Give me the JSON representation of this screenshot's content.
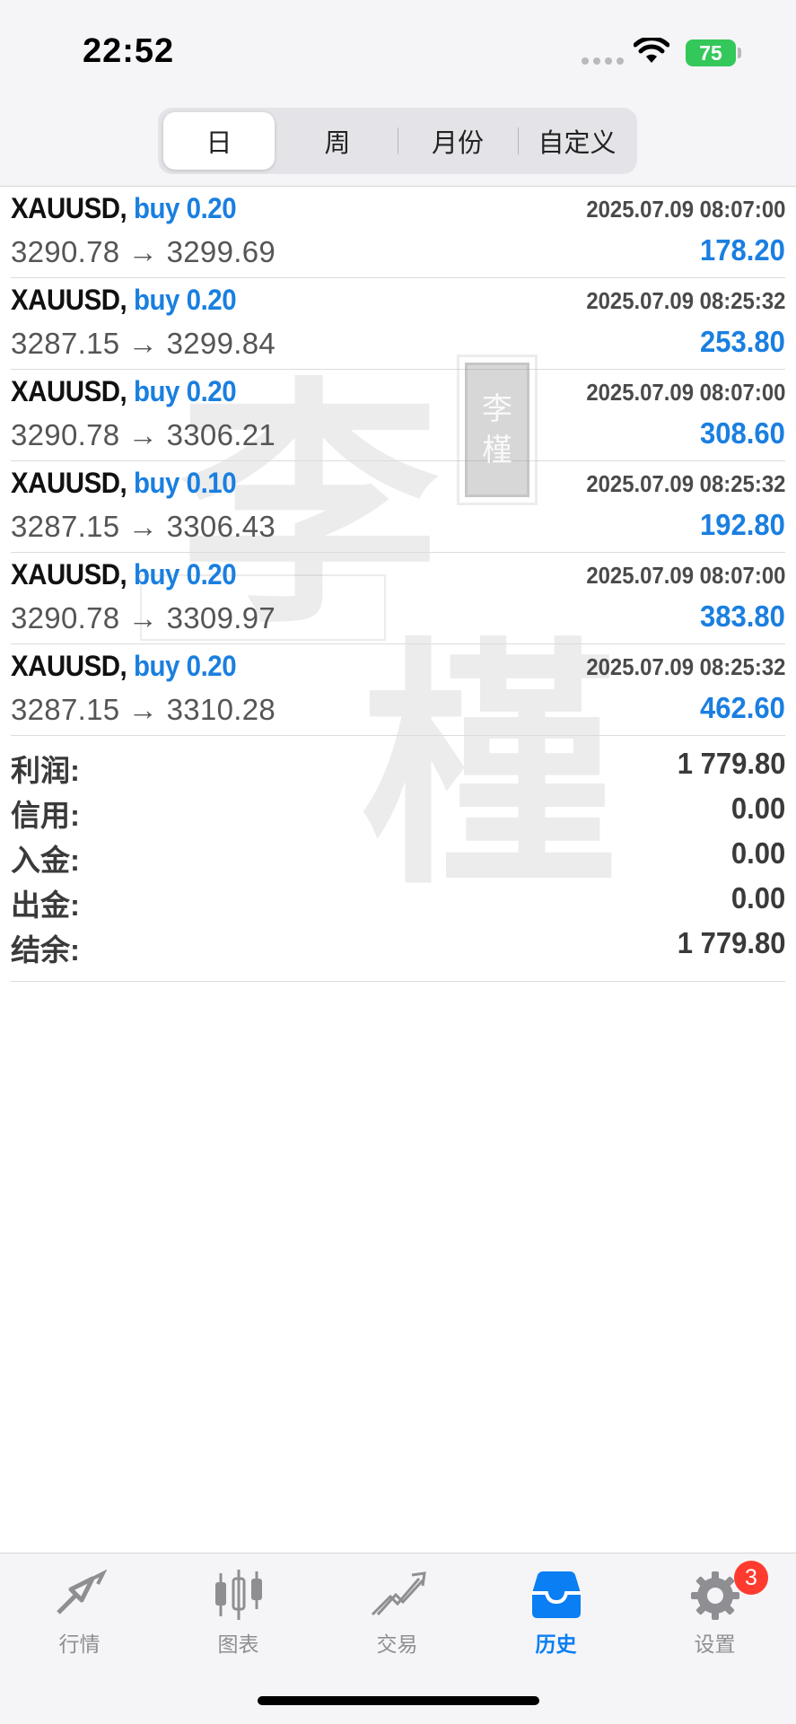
{
  "status_bar": {
    "time": "22:52",
    "battery": "75"
  },
  "period_tabs": [
    {
      "label": "日",
      "active": true
    },
    {
      "label": "周",
      "active": false
    },
    {
      "label": "月份",
      "active": false
    },
    {
      "label": "自定义",
      "active": false
    }
  ],
  "trades": [
    {
      "symbol": "XAUUSD,",
      "direction": "buy 0.20",
      "time": "2025.07.09 08:07:00",
      "prices": "3290.78 → 3299.69",
      "profit": "178.20"
    },
    {
      "symbol": "XAUUSD,",
      "direction": "buy 0.20",
      "time": "2025.07.09 08:25:32",
      "prices": "3287.15 → 3299.84",
      "profit": "253.80"
    },
    {
      "symbol": "XAUUSD,",
      "direction": "buy 0.20",
      "time": "2025.07.09 08:07:00",
      "prices": "3290.78 → 3306.21",
      "profit": "308.60"
    },
    {
      "symbol": "XAUUSD,",
      "direction": "buy 0.10",
      "time": "2025.07.09 08:25:32",
      "prices": "3287.15 → 3306.43",
      "profit": "192.80"
    },
    {
      "symbol": "XAUUSD,",
      "direction": "buy 0.20",
      "time": "2025.07.09 08:07:00",
      "prices": "3290.78 → 3309.97",
      "profit": "383.80"
    },
    {
      "symbol": "XAUUSD,",
      "direction": "buy 0.20",
      "time": "2025.07.09 08:25:32",
      "prices": "3287.15 → 3310.28",
      "profit": "462.60"
    }
  ],
  "summary": [
    {
      "label": "利润:",
      "value": "1 779.80"
    },
    {
      "label": "信用:",
      "value": "0.00"
    },
    {
      "label": "入金:",
      "value": "0.00"
    },
    {
      "label": "出金:",
      "value": "0.00"
    },
    {
      "label": "结余:",
      "value": "1 779.80"
    }
  ],
  "watermark": {
    "char1": "李",
    "char2": "槿",
    "seal": "李槿"
  },
  "tab_bar": [
    {
      "label": "行情",
      "icon": "quotes-icon",
      "active": false
    },
    {
      "label": "图表",
      "icon": "chart-icon",
      "active": false
    },
    {
      "label": "交易",
      "icon": "trade-icon",
      "active": false
    },
    {
      "label": "历史",
      "icon": "history-icon",
      "active": true
    },
    {
      "label": "设置",
      "icon": "gear-icon",
      "active": false,
      "badge": "3"
    }
  ],
  "colors": {
    "accent": "#0a7ef3",
    "profit": "#1a7fe0",
    "badge": "#ff3b30",
    "battery": "#34c759"
  }
}
